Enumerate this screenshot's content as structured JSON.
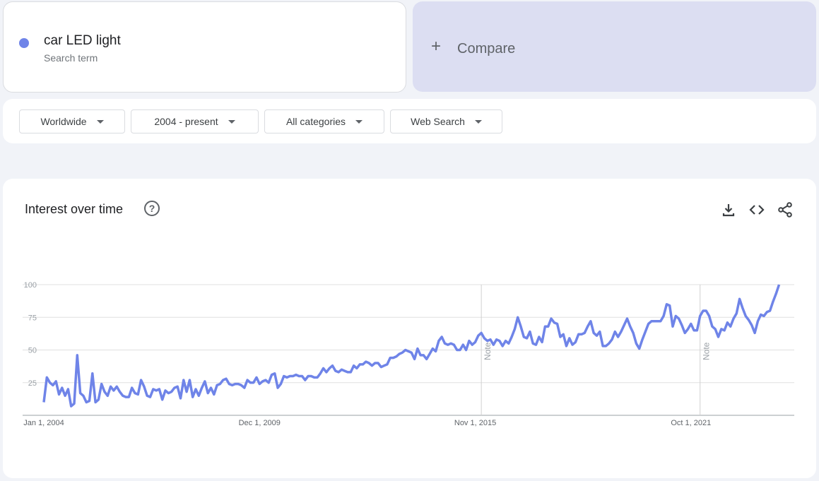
{
  "search_term": {
    "name": "car LED light",
    "subtitle": "Search term",
    "color": "#6f84e8"
  },
  "compare": {
    "label": "Compare"
  },
  "filters": {
    "region": "Worldwide",
    "time": "2004 - present",
    "category": "All categories",
    "property": "Web Search"
  },
  "chart_card": {
    "title": "Interest over time",
    "help_icon": "help-circle-icon",
    "actions": [
      "download-icon",
      "embed-code-icon",
      "share-icon"
    ]
  },
  "chart_data": {
    "type": "line",
    "title": "Interest over time",
    "x_range": [
      "2004-01",
      "2024-08"
    ],
    "ylim": [
      0,
      100
    ],
    "y_ticks": [
      25,
      50,
      75,
      100
    ],
    "x_tick_labels": [
      "Jan 1, 2004",
      "Dec 1, 2009",
      "Nov 1, 2015",
      "Oct 1, 2021"
    ],
    "note_label": "Note",
    "notes": [
      "2016-01",
      "2022-01"
    ],
    "grid": true,
    "series": [
      {
        "color": "#6f84e8",
        "points": [
          [
            "2004-01",
            10
          ],
          [
            "2004-02",
            29
          ],
          [
            "2004-03",
            25
          ],
          [
            "2004-04",
            23
          ],
          [
            "2004-05",
            26
          ],
          [
            "2004-06",
            16
          ],
          [
            "2004-07",
            21
          ],
          [
            "2004-08",
            15
          ],
          [
            "2004-09",
            20
          ],
          [
            "2004-10",
            7
          ],
          [
            "2004-11",
            9
          ],
          [
            "2004-12",
            46
          ],
          [
            "2005-01",
            17
          ],
          [
            "2005-02",
            15
          ],
          [
            "2005-03",
            10
          ],
          [
            "2005-04",
            11
          ],
          [
            "2005-05",
            32
          ],
          [
            "2005-06",
            10
          ],
          [
            "2005-07",
            12
          ],
          [
            "2005-08",
            24
          ],
          [
            "2005-09",
            18
          ],
          [
            "2005-10",
            15
          ],
          [
            "2005-11",
            22
          ],
          [
            "2005-12",
            19
          ],
          [
            "2006-01",
            22
          ],
          [
            "2006-02",
            18
          ],
          [
            "2006-03",
            15
          ],
          [
            "2006-04",
            14
          ],
          [
            "2006-05",
            14
          ],
          [
            "2006-06",
            21
          ],
          [
            "2006-07",
            17
          ],
          [
            "2006-08",
            16
          ],
          [
            "2006-09",
            27
          ],
          [
            "2006-10",
            22
          ],
          [
            "2006-11",
            15
          ],
          [
            "2006-12",
            14
          ],
          [
            "2007-01",
            20
          ],
          [
            "2007-02",
            19
          ],
          [
            "2007-03",
            20
          ],
          [
            "2007-04",
            12
          ],
          [
            "2007-05",
            19
          ],
          [
            "2007-06",
            17
          ],
          [
            "2007-07",
            18
          ],
          [
            "2007-08",
            21
          ],
          [
            "2007-09",
            22
          ],
          [
            "2007-10",
            13
          ],
          [
            "2007-11",
            27
          ],
          [
            "2007-12",
            18
          ],
          [
            "2008-01",
            27
          ],
          [
            "2008-02",
            14
          ],
          [
            "2008-03",
            20
          ],
          [
            "2008-04",
            15
          ],
          [
            "2008-05",
            21
          ],
          [
            "2008-06",
            26
          ],
          [
            "2008-07",
            17
          ],
          [
            "2008-08",
            21
          ],
          [
            "2008-09",
            16
          ],
          [
            "2008-10",
            23
          ],
          [
            "2008-11",
            24
          ],
          [
            "2008-12",
            27
          ],
          [
            "2009-01",
            28
          ],
          [
            "2009-02",
            24
          ],
          [
            "2009-03",
            23
          ],
          [
            "2009-04",
            24
          ],
          [
            "2009-05",
            24
          ],
          [
            "2009-06",
            23
          ],
          [
            "2009-07",
            21
          ],
          [
            "2009-08",
            27
          ],
          [
            "2009-09",
            25
          ],
          [
            "2009-10",
            25
          ],
          [
            "2009-11",
            29
          ],
          [
            "2009-12",
            24
          ],
          [
            "2010-01",
            26
          ],
          [
            "2010-02",
            27
          ],
          [
            "2010-03",
            25
          ],
          [
            "2010-04",
            31
          ],
          [
            "2010-05",
            32
          ],
          [
            "2010-06",
            21
          ],
          [
            "2010-07",
            24
          ],
          [
            "2010-08",
            30
          ],
          [
            "2010-09",
            29
          ],
          [
            "2010-10",
            30
          ],
          [
            "2010-11",
            30
          ],
          [
            "2010-12",
            31
          ],
          [
            "2011-01",
            30
          ],
          [
            "2011-02",
            30
          ],
          [
            "2011-03",
            27
          ],
          [
            "2011-04",
            30
          ],
          [
            "2011-05",
            30
          ],
          [
            "2011-06",
            29
          ],
          [
            "2011-07",
            29
          ],
          [
            "2011-08",
            32
          ],
          [
            "2011-09",
            36
          ],
          [
            "2011-10",
            33
          ],
          [
            "2011-11",
            36
          ],
          [
            "2011-12",
            38
          ],
          [
            "2012-01",
            34
          ],
          [
            "2012-02",
            33
          ],
          [
            "2012-03",
            35
          ],
          [
            "2012-04",
            34
          ],
          [
            "2012-05",
            33
          ],
          [
            "2012-06",
            33
          ],
          [
            "2012-07",
            38
          ],
          [
            "2012-08",
            36
          ],
          [
            "2012-09",
            39
          ],
          [
            "2012-10",
            39
          ],
          [
            "2012-11",
            41
          ],
          [
            "2012-12",
            40
          ],
          [
            "2013-01",
            38
          ],
          [
            "2013-02",
            40
          ],
          [
            "2013-03",
            40
          ],
          [
            "2013-04",
            37
          ],
          [
            "2013-05",
            38
          ],
          [
            "2013-06",
            39
          ],
          [
            "2013-07",
            44
          ],
          [
            "2013-08",
            44
          ],
          [
            "2013-09",
            45
          ],
          [
            "2013-10",
            47
          ],
          [
            "2013-11",
            48
          ],
          [
            "2013-12",
            50
          ],
          [
            "2014-01",
            49
          ],
          [
            "2014-02",
            48
          ],
          [
            "2014-03",
            43
          ],
          [
            "2014-04",
            51
          ],
          [
            "2014-05",
            46
          ],
          [
            "2014-06",
            46
          ],
          [
            "2014-07",
            43
          ],
          [
            "2014-08",
            47
          ],
          [
            "2014-09",
            51
          ],
          [
            "2014-10",
            49
          ],
          [
            "2014-11",
            57
          ],
          [
            "2014-12",
            60
          ],
          [
            "2015-01",
            55
          ],
          [
            "2015-02",
            54
          ],
          [
            "2015-03",
            55
          ],
          [
            "2015-04",
            54
          ],
          [
            "2015-05",
            50
          ],
          [
            "2015-06",
            50
          ],
          [
            "2015-07",
            54
          ],
          [
            "2015-08",
            50
          ],
          [
            "2015-09",
            57
          ],
          [
            "2015-10",
            54
          ],
          [
            "2015-11",
            56
          ],
          [
            "2015-12",
            61
          ],
          [
            "2016-01",
            63
          ],
          [
            "2016-02",
            59
          ],
          [
            "2016-03",
            57
          ],
          [
            "2016-04",
            58
          ],
          [
            "2016-05",
            54
          ],
          [
            "2016-06",
            58
          ],
          [
            "2016-07",
            57
          ],
          [
            "2016-08",
            53
          ],
          [
            "2016-09",
            57
          ],
          [
            "2016-10",
            55
          ],
          [
            "2016-11",
            60
          ],
          [
            "2016-12",
            66
          ],
          [
            "2017-01",
            75
          ],
          [
            "2017-02",
            68
          ],
          [
            "2017-03",
            60
          ],
          [
            "2017-04",
            59
          ],
          [
            "2017-05",
            64
          ],
          [
            "2017-06",
            55
          ],
          [
            "2017-07",
            54
          ],
          [
            "2017-08",
            60
          ],
          [
            "2017-09",
            56
          ],
          [
            "2017-10",
            68
          ],
          [
            "2017-11",
            68
          ],
          [
            "2017-12",
            74
          ],
          [
            "2018-01",
            71
          ],
          [
            "2018-02",
            70
          ],
          [
            "2018-03",
            60
          ],
          [
            "2018-04",
            62
          ],
          [
            "2018-05",
            53
          ],
          [
            "2018-06",
            59
          ],
          [
            "2018-07",
            54
          ],
          [
            "2018-08",
            56
          ],
          [
            "2018-09",
            62
          ],
          [
            "2018-10",
            62
          ],
          [
            "2018-11",
            63
          ],
          [
            "2018-12",
            68
          ],
          [
            "2019-01",
            72
          ],
          [
            "2019-02",
            63
          ],
          [
            "2019-03",
            61
          ],
          [
            "2019-04",
            64
          ],
          [
            "2019-05",
            53
          ],
          [
            "2019-06",
            53
          ],
          [
            "2019-07",
            55
          ],
          [
            "2019-08",
            58
          ],
          [
            "2019-09",
            64
          ],
          [
            "2019-10",
            60
          ],
          [
            "2019-11",
            64
          ],
          [
            "2019-12",
            69
          ],
          [
            "2020-01",
            74
          ],
          [
            "2020-02",
            68
          ],
          [
            "2020-03",
            63
          ],
          [
            "2020-04",
            55
          ],
          [
            "2020-05",
            51
          ],
          [
            "2020-06",
            58
          ],
          [
            "2020-07",
            64
          ],
          [
            "2020-08",
            70
          ],
          [
            "2020-09",
            72
          ],
          [
            "2020-10",
            72
          ],
          [
            "2020-11",
            72
          ],
          [
            "2020-12",
            72
          ],
          [
            "2021-01",
            76
          ],
          [
            "2021-02",
            85
          ],
          [
            "2021-03",
            84
          ],
          [
            "2021-04",
            68
          ],
          [
            "2021-05",
            76
          ],
          [
            "2021-06",
            74
          ],
          [
            "2021-07",
            69
          ],
          [
            "2021-08",
            63
          ],
          [
            "2021-09",
            66
          ],
          [
            "2021-10",
            70
          ],
          [
            "2021-11",
            65
          ],
          [
            "2021-12",
            65
          ],
          [
            "2022-01",
            76
          ],
          [
            "2022-02",
            80
          ],
          [
            "2022-03",
            80
          ],
          [
            "2022-04",
            76
          ],
          [
            "2022-05",
            68
          ],
          [
            "2022-06",
            66
          ],
          [
            "2022-07",
            60
          ],
          [
            "2022-08",
            66
          ],
          [
            "2022-09",
            65
          ],
          [
            "2022-10",
            71
          ],
          [
            "2022-11",
            68
          ],
          [
            "2022-12",
            74
          ],
          [
            "2023-01",
            78
          ],
          [
            "2023-02",
            89
          ],
          [
            "2023-03",
            82
          ],
          [
            "2023-04",
            76
          ],
          [
            "2023-05",
            73
          ],
          [
            "2023-06",
            69
          ],
          [
            "2023-07",
            63
          ],
          [
            "2023-08",
            72
          ],
          [
            "2023-09",
            77
          ],
          [
            "2023-10",
            76
          ],
          [
            "2023-11",
            79
          ],
          [
            "2023-12",
            80
          ],
          [
            "2024-01",
            87
          ],
          [
            "2024-02",
            93
          ],
          [
            "2024-03",
            100
          ]
        ]
      }
    ]
  }
}
